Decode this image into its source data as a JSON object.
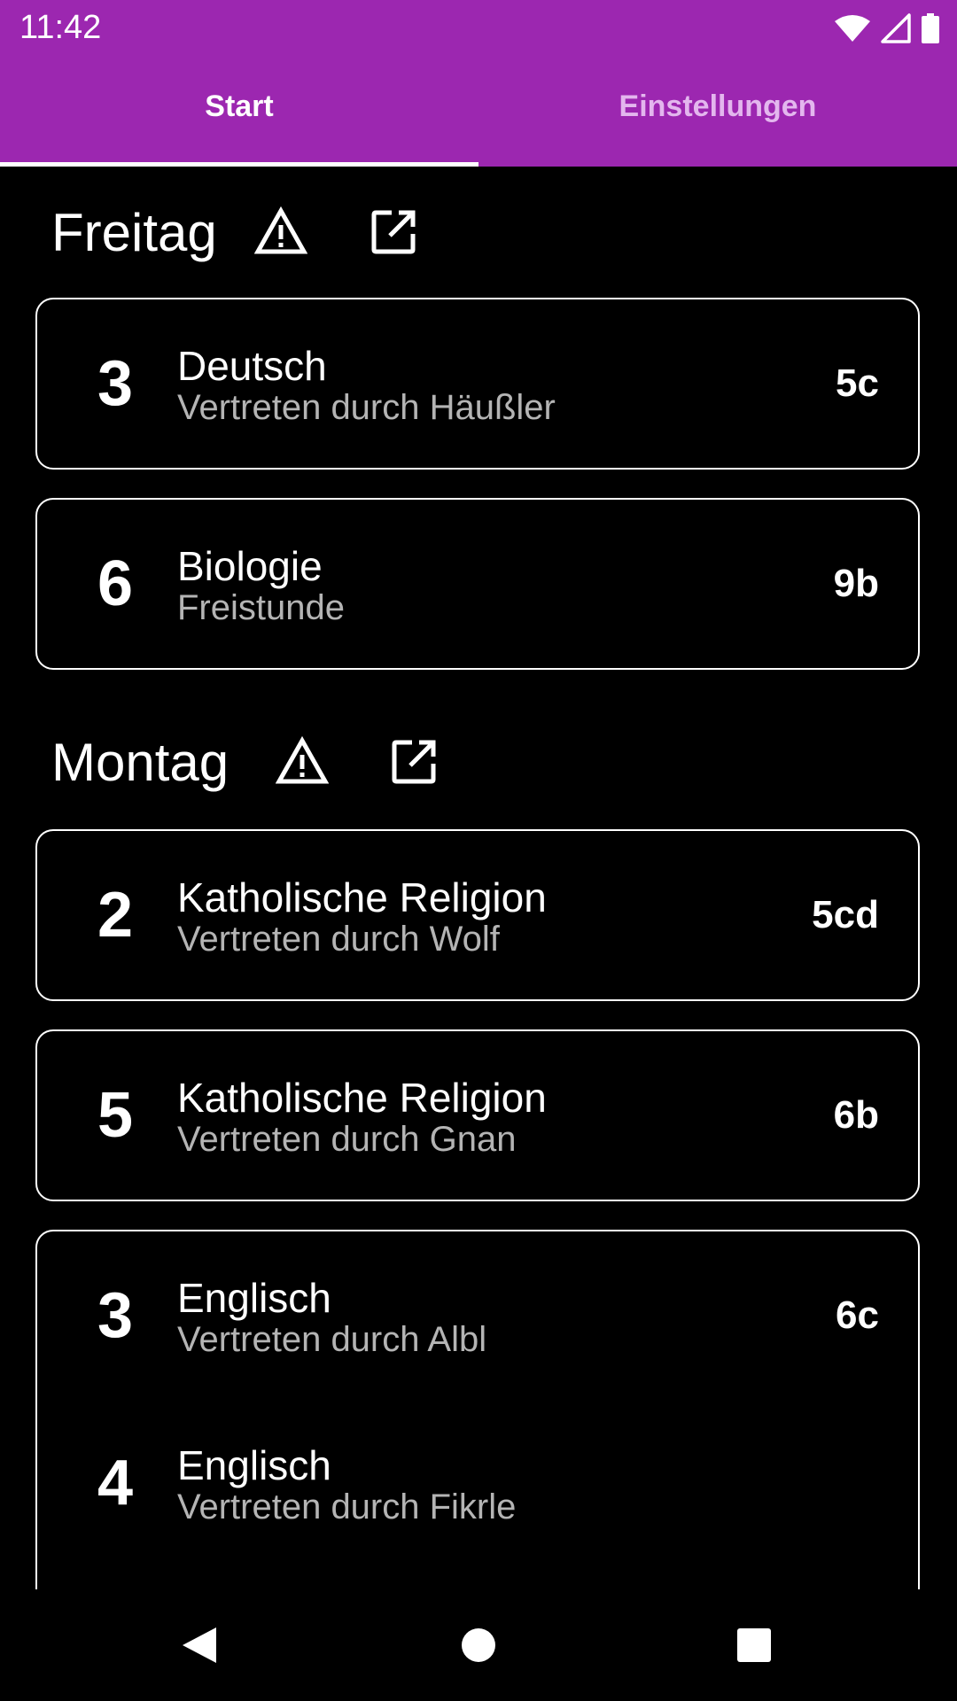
{
  "status_bar": {
    "time": "11:42",
    "icons": [
      "wifi-icon",
      "signal-icon",
      "battery-icon"
    ]
  },
  "tabs": [
    {
      "label": "Start",
      "selected": true
    },
    {
      "label": "Einstellungen",
      "selected": false
    }
  ],
  "colors": {
    "accent": "#9c27b0",
    "inactive_tab": "#e3b6ee",
    "secondary_text": "#b4b4b4"
  },
  "days": [
    {
      "title": "Freitag",
      "cards": [
        {
          "rows": [
            {
              "period": "3",
              "subject": "Deutsch",
              "info": "Vertreten durch Häußler",
              "class": "5c"
            }
          ]
        },
        {
          "rows": [
            {
              "period": "6",
              "subject": "Biologie",
              "info": "Freistunde",
              "class": "9b"
            }
          ]
        }
      ]
    },
    {
      "title": "Montag",
      "cards": [
        {
          "rows": [
            {
              "period": "2",
              "subject": "Katholische Religion",
              "info": "Vertreten durch Wolf",
              "class": "5cd"
            }
          ]
        },
        {
          "rows": [
            {
              "period": "5",
              "subject": "Katholische Religion",
              "info": "Vertreten durch Gnan",
              "class": "6b"
            }
          ]
        },
        {
          "rows": [
            {
              "period": "3",
              "subject": "Englisch",
              "info": "Vertreten durch Albl",
              "class": "6c"
            },
            {
              "period": "4",
              "subject": "Englisch",
              "info": "Vertreten durch Fikrle",
              "class": ""
            }
          ]
        }
      ]
    }
  ],
  "nav": [
    "back-icon",
    "home-icon",
    "recents-icon"
  ]
}
